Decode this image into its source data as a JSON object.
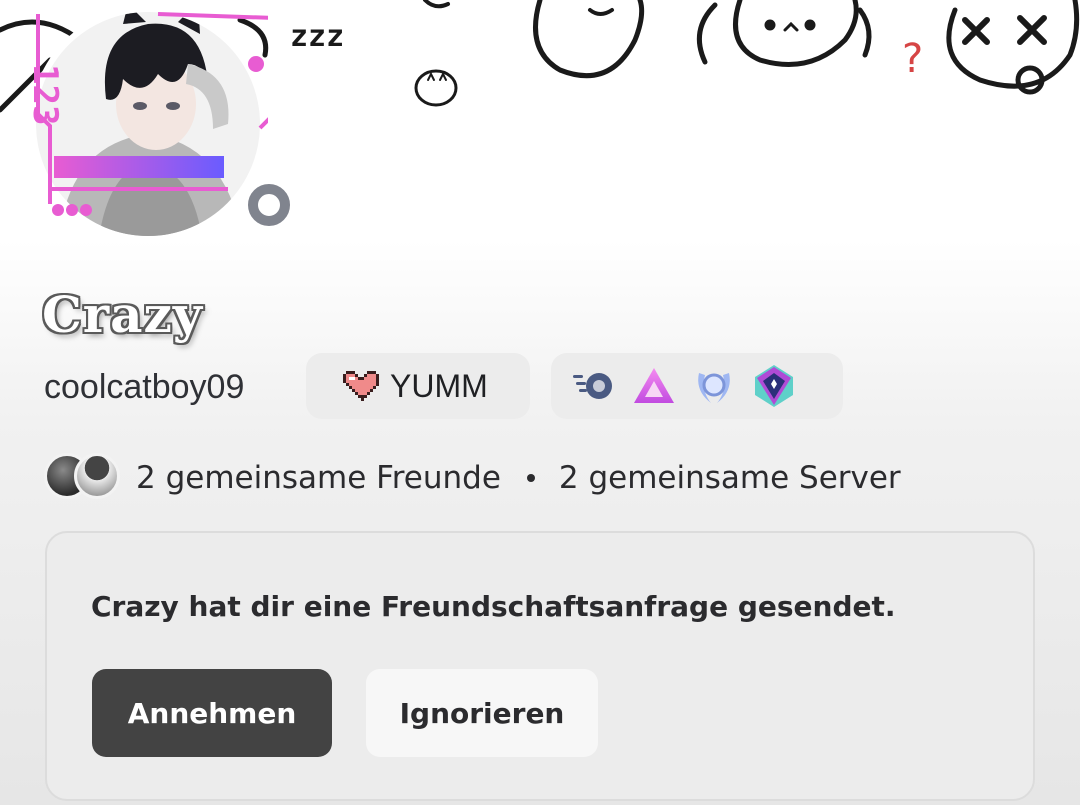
{
  "profile": {
    "display_name": "Crazy",
    "username": "coolcatboy09",
    "status": "offline"
  },
  "banner": {
    "doodle_text": "zzz"
  },
  "clan_tag": {
    "label": "YUMM",
    "icon": "pixel-heart-icon"
  },
  "badges": [
    {
      "icon": "nitro-badge-icon"
    },
    {
      "icon": "hypesquad-triangle-badge-icon"
    },
    {
      "icon": "laurel-badge-icon"
    },
    {
      "icon": "server-boost-gem-badge-icon"
    }
  ],
  "mutuals": {
    "friends": "2 gemeinsame Freunde",
    "servers": "2 gemeinsame Server"
  },
  "friend_request": {
    "message": "Crazy hat dir eine Freundschaftsanfrage gesendet.",
    "accept_label": "Annehmen",
    "ignore_label": "Ignorieren"
  },
  "colors": {
    "accept_bg": "#434343",
    "card_bg": "#ececec",
    "status_offline": "#80848e",
    "decoration_pink": "#e85cd2"
  }
}
